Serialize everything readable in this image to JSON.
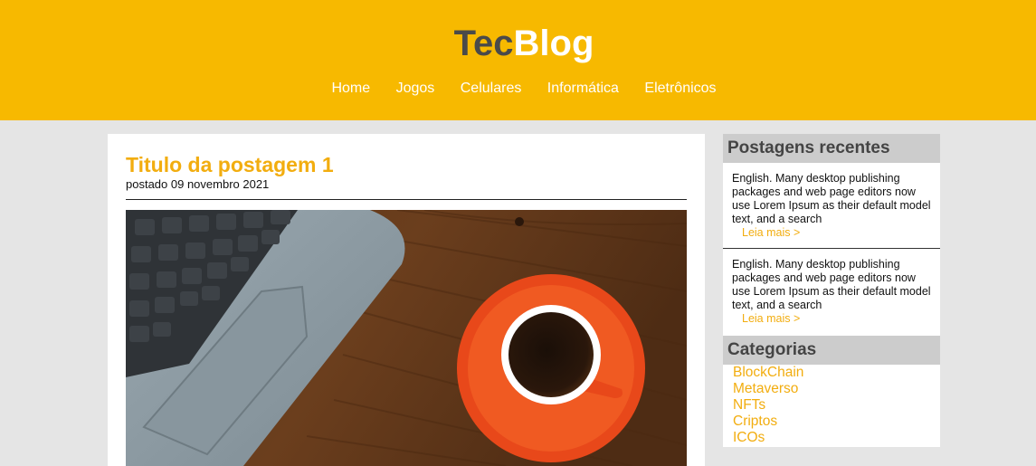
{
  "header": {
    "logo_part1": "Tec",
    "logo_part2": "Blog",
    "nav": [
      "Home",
      "Jogos",
      "Celulares",
      "Informática",
      "Eletrônicos"
    ]
  },
  "post": {
    "title": "Titulo da postagem 1",
    "meta": "postado 09 novembro 2021",
    "image_alt": "laptop and coffee cup on wooden desk"
  },
  "sidebar": {
    "recent_heading": "Postagens recentes",
    "recent": [
      {
        "text": "English. Many desktop publishing packages and web page editors now use Lorem Ipsum as their default model text, and a search",
        "link": "Leia mais >"
      },
      {
        "text": "English. Many desktop publishing packages and web page editors now use Lorem Ipsum as their default model text, and a search",
        "link": "Leia mais >"
      }
    ],
    "categories_heading": "Categorias",
    "categories": [
      "BlockChain",
      "Metaverso",
      "NFTs",
      "Criptos",
      "ICOs"
    ]
  },
  "colors": {
    "header": "#f7b900",
    "accent": "#f2ad0f",
    "background": "#e5e5e5",
    "sidebar_heading": "#cccccc"
  }
}
